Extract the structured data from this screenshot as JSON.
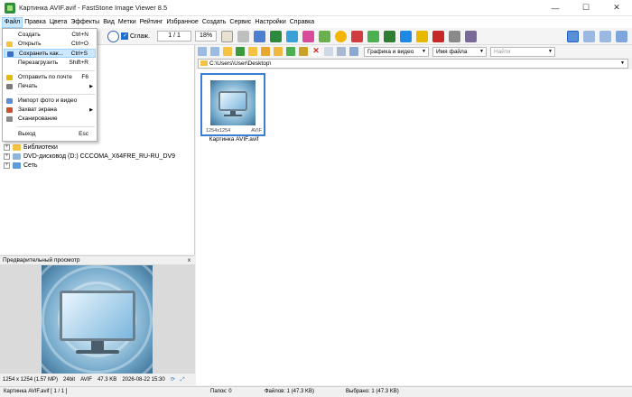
{
  "window": {
    "title": "Картинка AVIF.avif  -  FastStone Image Viewer 8.5",
    "minimize": "—",
    "maximize": "☐",
    "close": "✕"
  },
  "menubar": {
    "items": [
      "Файл",
      "Правка",
      "Цвета",
      "Эффекты",
      "Вид",
      "Метки",
      "Рейтинг",
      "Избранное",
      "Создать",
      "Сервис",
      "Настройки",
      "Справка"
    ]
  },
  "toolbar": {
    "page": "1 / 1",
    "zoom": "18%",
    "smooth_label": "Сглаж."
  },
  "file_menu": {
    "items": [
      {
        "label": "Создать",
        "shortcut": "Ctrl+N"
      },
      {
        "label": "Открыть",
        "shortcut": "Ctrl+O"
      },
      {
        "label": "Сохранить как...",
        "shortcut": "Ctrl+S"
      },
      {
        "label": "Перезагрузить",
        "shortcut": "Shift+R"
      },
      {
        "label": "Отправить по почте",
        "shortcut": "F6"
      },
      {
        "label": "Печать",
        "shortcut": ""
      },
      {
        "label": "Импорт фото и видео",
        "shortcut": ""
      },
      {
        "label": "Захват экрана",
        "shortcut": ""
      },
      {
        "label": "Сканирование",
        "shortcut": ""
      },
      {
        "label": "Выход",
        "shortcut": "Esc"
      }
    ]
  },
  "tree": {
    "items": [
      "Библиотеки",
      "DVD-дисковод (D:) CCCOMA_X64FRE_RU-RU_DV9",
      "Сеть"
    ]
  },
  "preview": {
    "header": "Предварительный просмотр",
    "pin": "x",
    "status": {
      "dimensions": "1254 x 1254 (1.57 MP)",
      "bits": "24bit",
      "format": "AVIF",
      "size": "47.3 KB",
      "date": "2026-08-22 15:30"
    }
  },
  "filters": {
    "type": "Графика и видео",
    "sort": "Имя файла",
    "search_placeholder": "Найти"
  },
  "path": "C:\\Users\\User\\Desktop\\",
  "thumbnail": {
    "dimensions": "1254x1254",
    "format": "AVIF",
    "filename": "Картинка AVIF.avif"
  },
  "statusbar": {
    "file": "Картинка AVIF.avif [ 1 / 1 ]",
    "folders": "Папок: 0",
    "files": "Файлов: 1 (47.3 KB)",
    "selected": "Выбрано: 1 (47.3 KB)"
  }
}
